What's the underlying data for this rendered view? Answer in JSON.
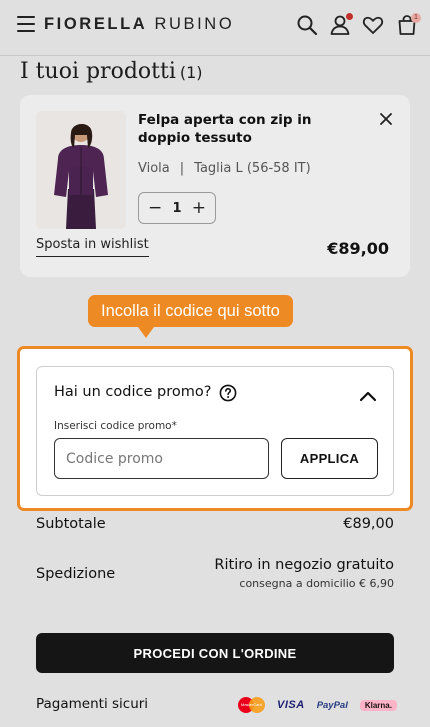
{
  "header": {
    "brand_part1": "FIORELLA",
    "brand_part2": "RUBINO",
    "icons": [
      "menu-icon",
      "search-icon",
      "user-icon",
      "heart-icon",
      "bag-icon"
    ],
    "cart_count": "1"
  },
  "page": {
    "title": "I tuoi prodotti",
    "count": "(1)"
  },
  "product": {
    "name": "Felpa aperta con zip in doppio tessuto",
    "color": "Viola",
    "separator": "|",
    "size": "Taglia L (56-58 IT)",
    "quantity": "1",
    "minus": "−",
    "plus": "+",
    "wishlist_label": "Sposta in wishlist",
    "price": "€89,00"
  },
  "tooltip": {
    "text": "Incolla il codice qui sotto"
  },
  "promo": {
    "title": "Hai un codice promo?",
    "input_label": "Inserisci codice promo*",
    "placeholder": "Codice promo",
    "apply_label": "APPLICA"
  },
  "summary": {
    "subtotal_label": "Subtotale",
    "subtotal_value": "€89,00",
    "shipping_label": "Spedizione",
    "shipping_value": "Ritiro in negozio gratuito",
    "shipping_sub": "consegna a domicilio € 6,90",
    "checkout_label": "PROCEDI CON L'ORDINE",
    "payments_label": "Pagamenti sicuri",
    "payment_methods": [
      "MasterCard",
      "VISA",
      "PayPal",
      "Klarna."
    ]
  },
  "colors": {
    "accent_orange": "#ee8a23",
    "checkout_bg": "#151515",
    "page_bg": "#e0e0e0"
  }
}
